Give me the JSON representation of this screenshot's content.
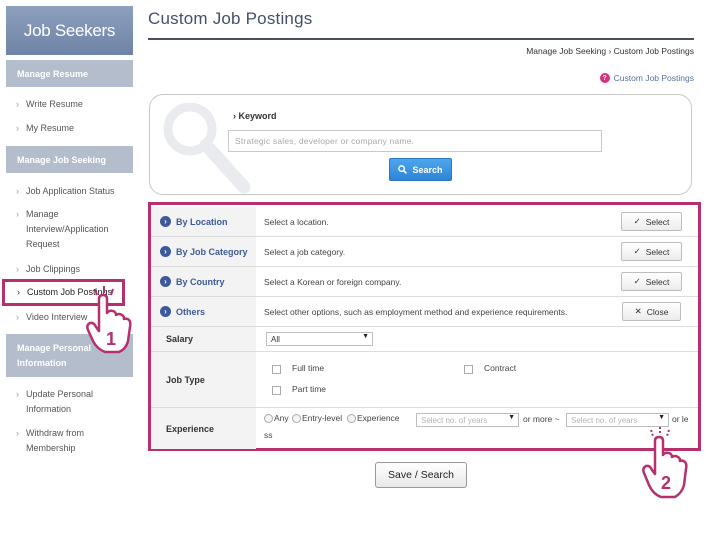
{
  "sidebar": {
    "brand": "Job Seekers",
    "sections": [
      {
        "title": "Manage Resume",
        "items": [
          "Write Resume",
          "My Resume"
        ]
      },
      {
        "title": "Manage Job Seeking",
        "items": [
          "Job Application Status",
          "Manage Interview/Application Request",
          "Job Clippings",
          "Custom Job Postings",
          "Video Interview"
        ]
      },
      {
        "title": "Manage Personal Information",
        "items": [
          "Update Personal Information",
          "Withdraw from Membership"
        ]
      }
    ]
  },
  "header": {
    "title": "Custom Job Postings",
    "breadcrumb": [
      "Manage Job Seeking",
      "Custom Job Postings"
    ],
    "help_link": "Custom Job Postings"
  },
  "search": {
    "keyword_label": "Keyword",
    "placeholder": "Strategic sales, developer or company name.",
    "button": "Search"
  },
  "filters": [
    {
      "label": "By Location",
      "description": "Select a location.",
      "button": "Select"
    },
    {
      "label": "By Job Category",
      "description": "Select a job category.",
      "button": "Select"
    },
    {
      "label": "By Country",
      "description": "Select a Korean or foreign company.",
      "button": "Select"
    },
    {
      "label": "Others",
      "description": "Select other options, such as employment method and experience requirements.",
      "button": "Close"
    }
  ],
  "others": {
    "salary_label": "Salary",
    "salary_value": "All",
    "job_type_label": "Job Type",
    "job_types": [
      "Full time",
      "Contract",
      "Part time"
    ],
    "experience_label": "Experience",
    "experience_options": [
      "Any",
      "Entry-level",
      "Experience"
    ],
    "years_placeholder": "Select no. of years",
    "or_more": "or more ~",
    "or_less_1": "or le",
    "or_less_2": "ss"
  },
  "save_button": "Save / Search",
  "annotations": {
    "step1": "1",
    "step2": "2"
  },
  "colors": {
    "accent": "#b5306c",
    "brand": "#7a8db0",
    "link": "#3c5a9a"
  }
}
